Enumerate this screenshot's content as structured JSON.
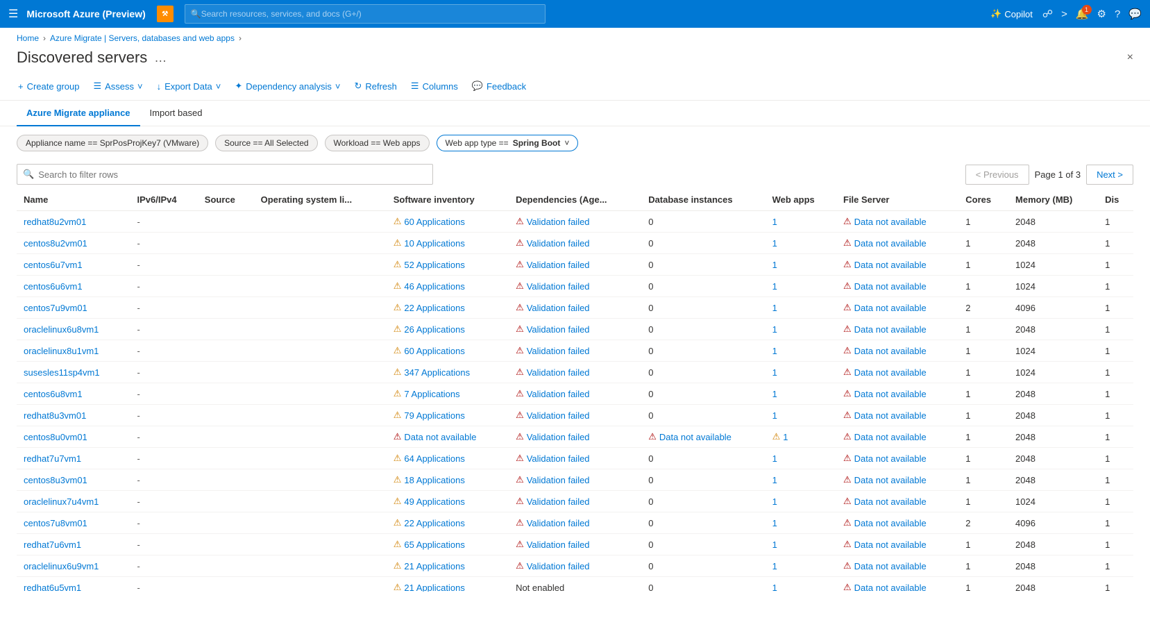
{
  "topbar": {
    "title": "Microsoft Azure (Preview)",
    "search_placeholder": "Search resources, services, and docs (G+/)",
    "copilot_label": "Copilot",
    "notif_count": "1"
  },
  "breadcrumb": {
    "items": [
      "Home",
      "Azure Migrate | Servers, databases and web apps"
    ]
  },
  "page": {
    "title": "Discovered servers",
    "close_label": "×"
  },
  "toolbar": {
    "create_group": "Create group",
    "assess": "Assess",
    "export_data": "Export Data",
    "dependency_analysis": "Dependency analysis",
    "refresh": "Refresh",
    "columns": "Columns",
    "feedback": "Feedback"
  },
  "tabs": [
    {
      "label": "Azure Migrate appliance",
      "active": true
    },
    {
      "label": "Import based",
      "active": false
    }
  ],
  "filters": [
    {
      "label": "Appliance name == SprPosProjKey7 (VMware)"
    },
    {
      "label": "Source == All Selected"
    },
    {
      "label": "Workload == Web apps"
    },
    {
      "label": "Web app type ==",
      "select": "Spring Boot"
    }
  ],
  "search": {
    "placeholder": "Search to filter rows"
  },
  "pagination": {
    "previous_label": "< Previous",
    "next_label": "Next >",
    "page_info": "Page 1 of 3"
  },
  "table": {
    "columns": [
      "Name",
      "IPv6/IPv4",
      "Source",
      "Operating system li...",
      "Software inventory",
      "Dependencies (Age...",
      "Database instances",
      "Web apps",
      "File Server",
      "Cores",
      "Memory (MB)",
      "Dis"
    ],
    "rows": [
      {
        "name": "redhat8u2vm01",
        "ipv": "-",
        "source": "",
        "os": "",
        "sw_count": "60",
        "sw_label": "Applications",
        "sw_icon": "warn",
        "dep": "Validation failed",
        "dep_icon": "error",
        "db": "0",
        "webapps": "1",
        "fileserver": "Data not available",
        "fileserver_icon": "error",
        "cores": "1",
        "memory": "2048",
        "dis": "1"
      },
      {
        "name": "centos8u2vm01",
        "ipv": "-",
        "source": "",
        "os": "",
        "sw_count": "10",
        "sw_label": "Applications",
        "sw_icon": "warn",
        "dep": "Validation failed",
        "dep_icon": "error",
        "db": "0",
        "webapps": "1",
        "fileserver": "Data not available",
        "fileserver_icon": "error",
        "cores": "1",
        "memory": "2048",
        "dis": "1"
      },
      {
        "name": "centos6u7vm1",
        "ipv": "-",
        "source": "",
        "os": "",
        "sw_count": "52",
        "sw_label": "Applications",
        "sw_icon": "warn",
        "dep": "Validation failed",
        "dep_icon": "error",
        "db": "0",
        "webapps": "1",
        "fileserver": "Data not available",
        "fileserver_icon": "error",
        "cores": "1",
        "memory": "1024",
        "dis": "1"
      },
      {
        "name": "centos6u6vm1",
        "ipv": "-",
        "source": "",
        "os": "",
        "sw_count": "46",
        "sw_label": "Applications",
        "sw_icon": "warn",
        "dep": "Validation failed",
        "dep_icon": "error",
        "db": "0",
        "webapps": "1",
        "fileserver": "Data not available",
        "fileserver_icon": "error",
        "cores": "1",
        "memory": "1024",
        "dis": "1"
      },
      {
        "name": "centos7u9vm01",
        "ipv": "-",
        "source": "",
        "os": "",
        "sw_count": "22",
        "sw_label": "Applications",
        "sw_icon": "warn",
        "dep": "Validation failed",
        "dep_icon": "error",
        "db": "0",
        "webapps": "1",
        "fileserver": "Data not available",
        "fileserver_icon": "error",
        "cores": "2",
        "memory": "4096",
        "dis": "1"
      },
      {
        "name": "oraclelinux6u8vm1",
        "ipv": "-",
        "source": "",
        "os": "",
        "sw_count": "26",
        "sw_label": "Applications",
        "sw_icon": "warn",
        "dep": "Validation failed",
        "dep_icon": "error",
        "db": "0",
        "webapps": "1",
        "fileserver": "Data not available",
        "fileserver_icon": "error",
        "cores": "1",
        "memory": "2048",
        "dis": "1"
      },
      {
        "name": "oraclelinux8u1vm1",
        "ipv": "-",
        "source": "",
        "os": "",
        "sw_count": "60",
        "sw_label": "Applications",
        "sw_icon": "warn",
        "dep": "Validation failed",
        "dep_icon": "error",
        "db": "0",
        "webapps": "1",
        "fileserver": "Data not available",
        "fileserver_icon": "error",
        "cores": "1",
        "memory": "1024",
        "dis": "1"
      },
      {
        "name": "susesles11sp4vm1",
        "ipv": "-",
        "source": "",
        "os": "",
        "sw_count": "347",
        "sw_label": "Applications",
        "sw_icon": "warn",
        "dep": "Validation failed",
        "dep_icon": "error",
        "db": "0",
        "webapps": "1",
        "fileserver": "Data not available",
        "fileserver_icon": "error",
        "cores": "1",
        "memory": "1024",
        "dis": "1"
      },
      {
        "name": "centos6u8vm1",
        "ipv": "-",
        "source": "",
        "os": "",
        "sw_count": "7",
        "sw_label": "Applications",
        "sw_icon": "warn",
        "dep": "Validation failed",
        "dep_icon": "error",
        "db": "0",
        "webapps": "1",
        "fileserver": "Data not available",
        "fileserver_icon": "error",
        "cores": "1",
        "memory": "2048",
        "dis": "1"
      },
      {
        "name": "redhat8u3vm01",
        "ipv": "-",
        "source": "",
        "os": "",
        "sw_count": "79",
        "sw_label": "Applications",
        "sw_icon": "warn",
        "dep": "Validation failed",
        "dep_icon": "error",
        "db": "0",
        "webapps": "1",
        "fileserver": "Data not available",
        "fileserver_icon": "error",
        "cores": "1",
        "memory": "2048",
        "dis": "1"
      },
      {
        "name": "centos8u0vm01",
        "ipv": "-",
        "source": "",
        "os": "",
        "sw_count": "",
        "sw_label": "Data not available",
        "sw_icon": "error",
        "dep": "Validation failed",
        "dep_icon": "error",
        "db": "Data not available",
        "db_icon": "error",
        "webapps": "1",
        "webapps_warn": true,
        "fileserver": "Data not available",
        "fileserver_icon": "error",
        "cores": "1",
        "memory": "2048",
        "dis": "1"
      },
      {
        "name": "redhat7u7vm1",
        "ipv": "-",
        "source": "",
        "os": "",
        "sw_count": "64",
        "sw_label": "Applications",
        "sw_icon": "warn",
        "dep": "Validation failed",
        "dep_icon": "error",
        "db": "0",
        "webapps": "1",
        "fileserver": "Data not available",
        "fileserver_icon": "error",
        "cores": "1",
        "memory": "2048",
        "dis": "1"
      },
      {
        "name": "centos8u3vm01",
        "ipv": "-",
        "source": "",
        "os": "",
        "sw_count": "18",
        "sw_label": "Applications",
        "sw_icon": "warn",
        "dep": "Validation failed",
        "dep_icon": "error",
        "db": "0",
        "webapps": "1",
        "fileserver": "Data not available",
        "fileserver_icon": "error",
        "cores": "1",
        "memory": "2048",
        "dis": "1"
      },
      {
        "name": "oraclelinux7u4vm1",
        "ipv": "-",
        "source": "",
        "os": "",
        "sw_count": "49",
        "sw_label": "Applications",
        "sw_icon": "warn",
        "dep": "Validation failed",
        "dep_icon": "error",
        "db": "0",
        "webapps": "1",
        "fileserver": "Data not available",
        "fileserver_icon": "error",
        "cores": "1",
        "memory": "1024",
        "dis": "1"
      },
      {
        "name": "centos7u8vm01",
        "ipv": "-",
        "source": "",
        "os": "",
        "sw_count": "22",
        "sw_label": "Applications",
        "sw_icon": "warn",
        "dep": "Validation failed",
        "dep_icon": "error",
        "db": "0",
        "webapps": "1",
        "fileserver": "Data not available",
        "fileserver_icon": "error",
        "cores": "2",
        "memory": "4096",
        "dis": "1"
      },
      {
        "name": "redhat7u6vm1",
        "ipv": "-",
        "source": "",
        "os": "",
        "sw_count": "65",
        "sw_label": "Applications",
        "sw_icon": "warn",
        "dep": "Validation failed",
        "dep_icon": "error",
        "db": "0",
        "webapps": "1",
        "fileserver": "Data not available",
        "fileserver_icon": "error",
        "cores": "1",
        "memory": "2048",
        "dis": "1"
      },
      {
        "name": "oraclelinux6u9vm1",
        "ipv": "-",
        "source": "",
        "os": "",
        "sw_count": "21",
        "sw_label": "Applications",
        "sw_icon": "warn",
        "dep": "Validation failed",
        "dep_icon": "error",
        "db": "0",
        "webapps": "1",
        "fileserver": "Data not available",
        "fileserver_icon": "error",
        "cores": "1",
        "memory": "2048",
        "dis": "1"
      },
      {
        "name": "redhat6u5vm1",
        "ipv": "-",
        "source": "",
        "os": "",
        "sw_count": "21",
        "sw_label": "Applications",
        "sw_icon": "warn",
        "dep": "Not enabled",
        "dep_icon": "none",
        "db": "0",
        "webapps": "1",
        "fileserver": "Data not available",
        "fileserver_icon": "error",
        "cores": "1",
        "memory": "2048",
        "dis": "1"
      }
    ]
  }
}
